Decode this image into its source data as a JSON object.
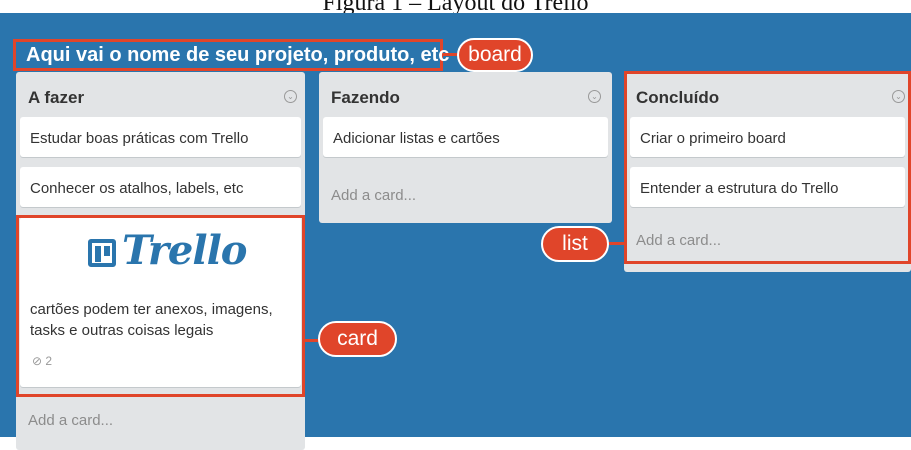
{
  "figure_caption": "Figura 1 – Layout do Trello",
  "board": {
    "title": "Aqui vai o nome de seu projeto, produto, etc",
    "background": "#2a75ad"
  },
  "callouts": {
    "board": "board",
    "list": "list",
    "card": "card",
    "color": "#e0452a"
  },
  "lists": [
    {
      "title": "A fazer",
      "cards": [
        "Estudar boas práticas com Trello",
        "Conhecer os atalhos, labels, etc"
      ],
      "rich_card": {
        "logo_text": "Trello",
        "description": "cartões podem ter anexos, imagens, tasks e outras coisas legais",
        "attachment_count": "2"
      },
      "add_card": "Add a card..."
    },
    {
      "title": "Fazendo",
      "cards": [
        "Adicionar listas e cartões"
      ],
      "add_card": "Add a card..."
    },
    {
      "title": "Concluído",
      "cards": [
        "Criar o primeiro board",
        "Entender a estrutura do Trello"
      ],
      "add_card": "Add a card..."
    }
  ],
  "icons": {
    "list_menu": "chevron-down-circle-icon",
    "attachment": "paperclip-icon"
  }
}
